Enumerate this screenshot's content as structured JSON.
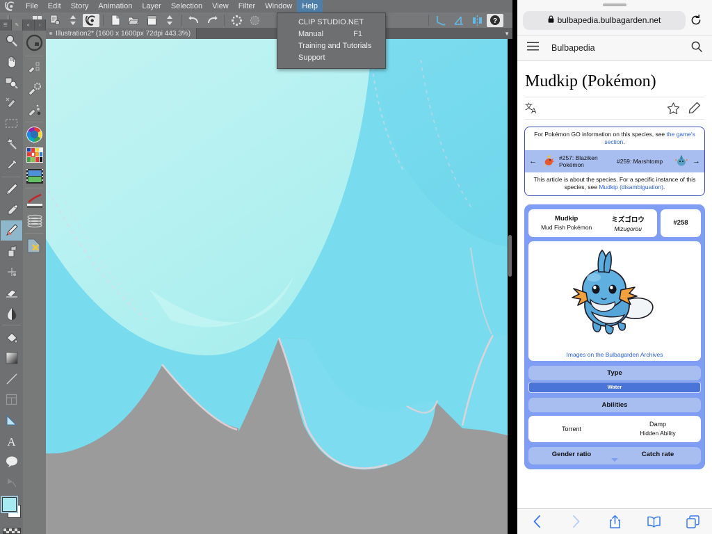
{
  "clip_studio": {
    "app_logo": "clip-studio-paint-logo",
    "menus": [
      {
        "label": "File"
      },
      {
        "label": "Edit"
      },
      {
        "label": "Story"
      },
      {
        "label": "Animation"
      },
      {
        "label": "Layer"
      },
      {
        "label": "Selection"
      },
      {
        "label": "View"
      },
      {
        "label": "Filter"
      },
      {
        "label": "Window"
      },
      {
        "label": "Help",
        "active": true
      }
    ],
    "help_menu": {
      "items": [
        {
          "label": "CLIP STUDIO.NET",
          "shortcut": ""
        },
        {
          "label": "Manual",
          "shortcut": "F1"
        },
        {
          "label": "Training and Tutorials",
          "shortcut": ""
        },
        {
          "label": "Support",
          "shortcut": ""
        }
      ]
    },
    "command_bar": {
      "icons": [
        "launcher-grid-icon",
        "new-from-clipboard-icon",
        "updown-arrows-icon",
        "clip-studio-spiral-icon",
        "new-document-icon",
        "open-file-icon",
        "save-icon",
        "updown-arrows-icon-2",
        "undo-icon",
        "redo-icon",
        "clear-selection-icon",
        "fill-selection-icon",
        "snap-parallel-icon",
        "snap-perspective-icon",
        "snap-symmetry-icon",
        "help-question-icon"
      ]
    },
    "document_tab": {
      "title": "Illustration2* (1600 x 1600px 72dpi 443.3%)",
      "modified": true
    },
    "tool_tabs": [
      "layer-list-tab",
      "tool-property-tab"
    ],
    "tools_primary": [
      "magnifier-tool",
      "hand-tool",
      "rotate-canvas-tool",
      "move-layer-tool",
      "selection-marquee-tool",
      "auto-select-tool",
      "eyedropper-tool",
      "pencil-tool",
      "airbrush-tool",
      "brush-tool",
      "decoration-tool",
      "eraser-tool",
      "blend-tool",
      "fill-tool",
      "gradient-tool",
      "figure-line-tool",
      "frame-border-tool",
      "ruler-tool",
      "text-tool",
      "balloon-tool",
      "correct-line-tool"
    ],
    "selected_tool": "brush-tool",
    "tools_secondary": [
      "quick-access-tool",
      "sub-tool-detail",
      "sub-tool-settings",
      "sub-tool-dots",
      "color-wheel",
      "color-set",
      "color-slider",
      "sub-view",
      "layer-properties",
      "quick-mask"
    ],
    "color_swatches": {
      "foreground": "#a7e9f0",
      "background": "#ffffff",
      "transparent": "transparent-checker"
    },
    "canvas": {
      "description": "zoomed-in digital painting of a Mudkip in light cyan on gray background",
      "colors": {
        "light_cyan": "#b2f0f0",
        "cyan": "#7adcee",
        "gray": "#9b9b9b",
        "outline_pink": "#e8c7cd"
      }
    },
    "scrollbar": "vertical-scrollbar"
  },
  "safari": {
    "url": "bulbapedia.bulbagarden.net",
    "lock_icon": "lock-icon",
    "reload_icon": "reload-icon",
    "site_header": {
      "menu_icon": "hamburger-menu-icon",
      "site_name": "Bulbapedia",
      "search_icon": "search-icon"
    },
    "page": {
      "title": "Mudkip (Pokémon)",
      "actions": {
        "language_icon": "language-translate-icon",
        "watch_icon": "star-watch-icon",
        "edit_icon": "pencil-edit-icon"
      },
      "hatnote": {
        "line1_pre": "For Pokémon GO information on this species, see ",
        "line1_link": "the game's section",
        "line1_post": ".",
        "prev_arrow": "←",
        "prev_sprite": "blaziken-sprite-icon",
        "prev_label": "#257: Blaziken Pokémon",
        "next_label": "#259: Marshtomp",
        "next_sprite": "marshtomp-sprite-icon",
        "next_arrow": "→",
        "line3_pre": "This article is about the species. For a specific instance of this species, see ",
        "line3_link": "Mudkip (disambiguation)",
        "line3_post": "."
      },
      "infobox": {
        "name_en": "Mudkip",
        "category_en": "Mud Fish Pokémon",
        "name_jp": "ミズゴロウ",
        "name_romaji": "Mizugorou",
        "dex_number": "#258",
        "image_caption": "Images on the Bulbagarden Archives",
        "type_heading": "Type",
        "type_value": "Water",
        "abilities_heading": "Abilities",
        "ability_1": "Torrent",
        "ability_hidden": "Damp",
        "ability_hidden_label": "Hidden Ability",
        "gender_ratio_heading": "Gender ratio",
        "catch_rate_heading": "Catch rate"
      }
    },
    "bottom_bar": {
      "back_icon": "back-chevron-icon",
      "forward_icon": "forward-chevron-icon",
      "share_icon": "share-icon",
      "bookmarks_icon": "bookmarks-book-icon",
      "tabs_icon": "tabs-icon"
    }
  },
  "theme": {
    "csp_chrome": "#6f7072",
    "csp_accent": "#4f7fa8",
    "bulba_blue": "#7f9ef3",
    "bulba_light": "#a8bdf0",
    "link_blue": "#2b5fd9",
    "safari_blue": "#3a7bf2"
  }
}
